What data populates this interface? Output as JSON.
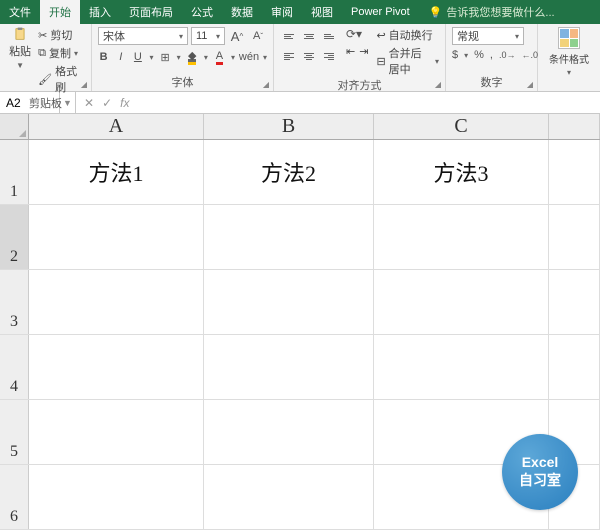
{
  "tabs": {
    "file": "文件",
    "home": "开始",
    "insert": "插入",
    "layout": "页面布局",
    "formulas": "公式",
    "data": "数据",
    "review": "审阅",
    "view": "视图",
    "powerpivot": "Power Pivot"
  },
  "tellme": "告诉我您想要做什么...",
  "ribbon": {
    "clipboard": {
      "paste": "粘贴",
      "cut": "剪切",
      "copy": "复制",
      "painter": "格式刷",
      "label": "剪贴板"
    },
    "font": {
      "name": "宋体",
      "size": "11",
      "bold": "B",
      "italic": "I",
      "underline": "U",
      "label": "字体"
    },
    "alignment": {
      "wrap": "自动换行",
      "merge": "合并后居中",
      "label": "对齐方式"
    },
    "number": {
      "format": "常规",
      "label": "数字"
    },
    "styles": {
      "cf": "条件格式"
    }
  },
  "namebox": "A2",
  "columns": [
    "A",
    "B",
    "C"
  ],
  "rows": [
    "1",
    "2",
    "3",
    "4",
    "5",
    "6"
  ],
  "cells": {
    "A1": "方法1",
    "B1": "方法2",
    "C1": "方法3"
  },
  "watermark": {
    "line1": "Excel",
    "line2": "自习室"
  }
}
